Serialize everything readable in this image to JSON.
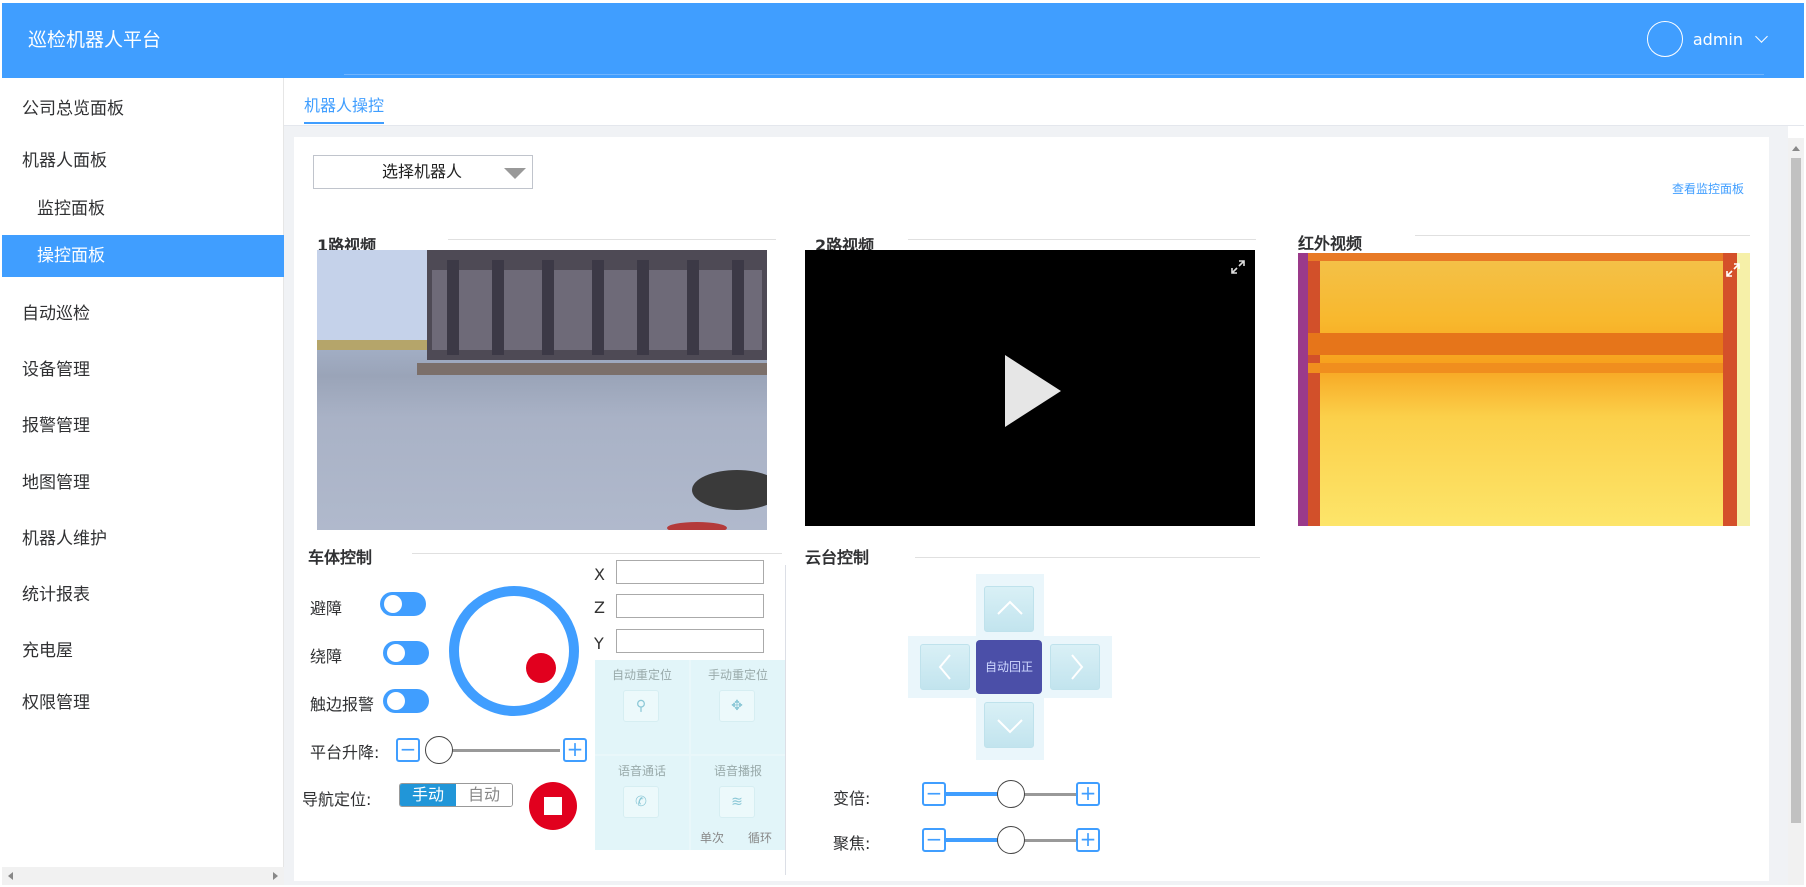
{
  "app": {
    "title": "巡检机器人平台"
  },
  "user": {
    "name": "admin"
  },
  "sidebar": {
    "items": [
      {
        "label": "公司总览面板"
      },
      {
        "label": "机器人面板"
      },
      {
        "label": "监控面板"
      },
      {
        "label": "操控面板"
      },
      {
        "label": "自动巡检"
      },
      {
        "label": "设备管理"
      },
      {
        "label": "报警管理"
      },
      {
        "label": "地图管理"
      },
      {
        "label": "机器人维护"
      },
      {
        "label": "统计报表"
      },
      {
        "label": "充电屋"
      },
      {
        "label": "权限管理"
      }
    ]
  },
  "tabs": [
    {
      "label": "机器人操控"
    }
  ],
  "toolbar": {
    "select_robot": "选择机器人",
    "view_monitor": "查看监控面板"
  },
  "videos": {
    "v1": "1路视频",
    "v2": "2路视频",
    "v3": "红外视频"
  },
  "car_control": {
    "title": "车体控制",
    "obstacle_avoid": "避障",
    "obstacle_detour": "绕障",
    "edge_alarm": "触边报警",
    "platform_lift": "平台升降:",
    "nav_position": "导航定位:",
    "nav_manual": "手动",
    "nav_auto": "自动",
    "x": "X",
    "z": "Z",
    "y": "Y",
    "auto_relocate": "自动重定位",
    "manual_relocate": "手动重定位",
    "voice_call": "语音通话",
    "voice_broadcast": "语音播报",
    "single": "单次",
    "loop": "循环",
    "platform_level": 0.1
  },
  "ptz_control": {
    "title": "云台控制",
    "center": "自动回正",
    "zoom_label": "变倍:",
    "focus_label": "聚焦:",
    "zoom_level": 0.5,
    "focus_level": 0.5
  },
  "colors": {
    "accent": "#409eff",
    "stop": "#e1001e",
    "ptz_center": "#4b4fa8"
  }
}
